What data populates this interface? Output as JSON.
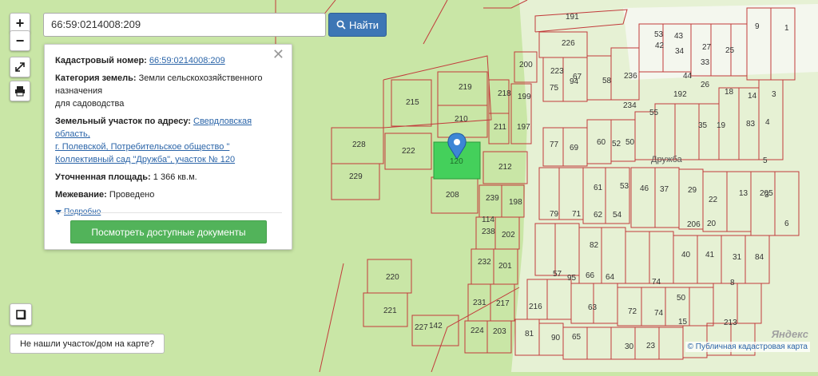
{
  "search": {
    "value": "66:59:0214008:209",
    "button_label": "Найти"
  },
  "controls": {
    "zoom_in": "+",
    "zoom_out": "−"
  },
  "info": {
    "cadastral_label": "Кадастровый номер:",
    "cadastral_value": "66:59:0214008:209",
    "category_label": "Категория земель:",
    "category_value_1": "Земли сельскохозяйственного",
    "category_value_2": "назначения",
    "category_value_3": "для садоводства",
    "address_label": "Земельный участок по адресу:",
    "address_1": "Свердловская область,",
    "address_2": "г. Полевской, Потребительское общество \"",
    "address_3": "Коллективный сад \"Дружба\", участок № 120",
    "area_label": "Уточненная площадь:",
    "area_value": "1 366 кв.м.",
    "survey_label": "Межевание:",
    "survey_value": "Проведено",
    "more_label": "Подробно",
    "docs_button": "Посмотреть доступные документы"
  },
  "not_found": "Не нашли участок/дом на карте?",
  "credit": "© Публичная кадастровая карта",
  "watermark": "Яндекс",
  "map": {
    "street_label": "Дружба",
    "selected_plot": "120",
    "plot_labels": [
      "191",
      "226",
      "215",
      "219",
      "228",
      "222",
      "229",
      "210",
      "218",
      "211",
      "200",
      "199",
      "197",
      "212",
      "208",
      "239",
      "198",
      "114",
      "238",
      "202",
      "232",
      "201",
      "231",
      "217",
      "224",
      "203",
      "227",
      "142",
      "220",
      "221",
      "223",
      "67",
      "94",
      "75",
      "58",
      "236",
      "53",
      "42",
      "34",
      "43",
      "44",
      "27",
      "33",
      "25",
      "77",
      "69",
      "60",
      "52",
      "50",
      "234",
      "55",
      "35",
      "19",
      "26",
      "18",
      "83",
      "14",
      "4",
      "3",
      "5",
      "9",
      "1",
      "192",
      "79",
      "71",
      "61",
      "62",
      "54",
      "53",
      "46",
      "37",
      "29",
      "22",
      "13",
      "205",
      "206",
      "20",
      "3",
      "6",
      "84",
      "8",
      "213",
      "216",
      "81",
      "82",
      "63",
      "65",
      "66",
      "64",
      "95",
      "57",
      "90",
      "72",
      "74",
      "74",
      "50",
      "40",
      "41",
      "31",
      "30",
      "23",
      "15",
      "237",
      "225",
      "193"
    ]
  }
}
